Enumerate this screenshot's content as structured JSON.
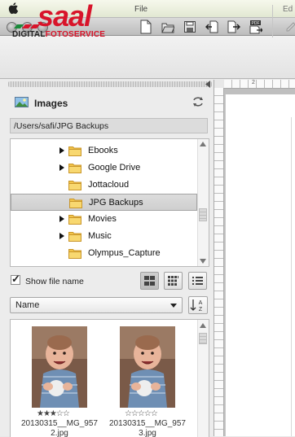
{
  "toolbar": {
    "logo_main": "saal",
    "logo_sub_left": "DIGITAL",
    "logo_sub_right": "FOTOSERVICE",
    "file_group_label": "File",
    "edit_group_label": "Ed",
    "file_buttons": [
      "new-document-icon",
      "open-folder-icon",
      "save-icon",
      "import-icon",
      "export-icon",
      "export-pdf-icon"
    ],
    "pdf_badge": "PDF"
  },
  "images_panel": {
    "title": "Images",
    "path": "/Users/safi/JPG Backups",
    "folders": [
      {
        "name": "Ebooks",
        "has_children": true,
        "selected": false
      },
      {
        "name": "Google Drive",
        "has_children": true,
        "selected": false
      },
      {
        "name": "Jottacloud",
        "has_children": false,
        "selected": false
      },
      {
        "name": "JPG Backups",
        "has_children": false,
        "selected": true
      },
      {
        "name": "Movies",
        "has_children": true,
        "selected": false
      },
      {
        "name": "Music",
        "has_children": true,
        "selected": false
      },
      {
        "name": "Olympus_Capture",
        "has_children": false,
        "selected": false
      }
    ],
    "show_file_name_label": "Show file name",
    "show_file_name_checked": true,
    "view_modes": [
      "large-grid-icon",
      "small-grid-icon",
      "list-view-icon"
    ],
    "active_view_mode": "large-grid-icon",
    "sort_by": "Name",
    "sort_direction_label": "AZ",
    "thumbnails": [
      {
        "filename_line1": "20130315__MG_957",
        "filename_line2": "2.jpg",
        "rating": 3,
        "max_rating": 5
      },
      {
        "filename_line1": "20130315__MG_957",
        "filename_line2": "3.jpg",
        "rating": 0,
        "max_rating": 5
      }
    ]
  },
  "canvas": {
    "ruler_label": "2"
  },
  "colors": {
    "brand_red": "#d8142a",
    "brand_green": "#1a8a3a",
    "folder_yellow": "#f2c44a"
  }
}
